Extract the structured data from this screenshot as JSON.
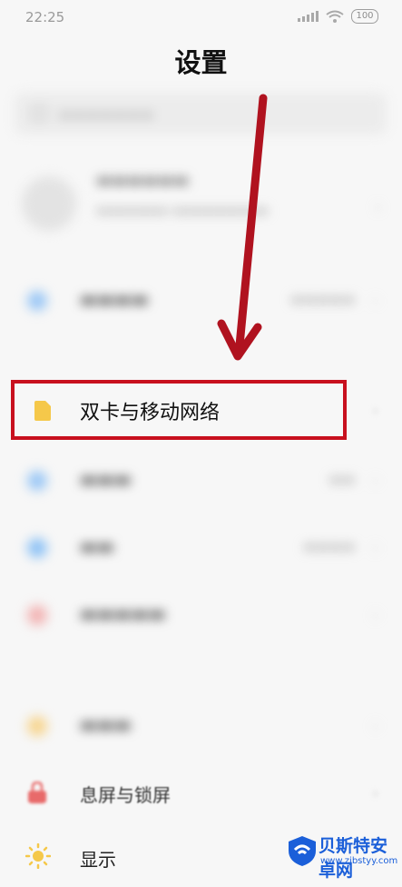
{
  "status_bar": {
    "time": "22:25",
    "battery": "100"
  },
  "header": {
    "title": "设置"
  },
  "highlighted_item": {
    "label": "双卡与移动网络"
  },
  "visible_items": [
    {
      "label": "息屏与锁屏"
    },
    {
      "label": "显示"
    }
  ],
  "watermark": {
    "name": "贝斯特安卓网",
    "url": "www.zjbstyy.com"
  },
  "colors": {
    "highlight_border": "#c8101e",
    "arrow": "#b0121f",
    "sim_icon": "#f5c84a",
    "display_icon": "#f5c84a",
    "lock_icon": "#e86a6a"
  }
}
